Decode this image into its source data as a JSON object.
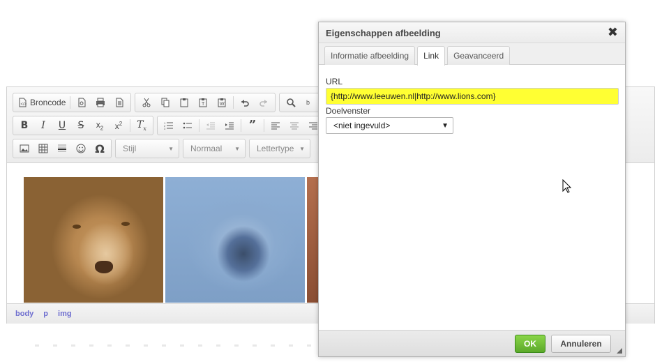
{
  "editor": {
    "toolbar": {
      "source_label": "Broncode",
      "style_combo": "Stijl",
      "format_combo": "Normaal",
      "font_combo": "Lettertype"
    },
    "statusbar": {
      "crumbs": [
        "body",
        "p",
        "img"
      ]
    }
  },
  "dialog": {
    "title": "Eigenschappen afbeelding",
    "tabs": [
      "Informatie afbeelding",
      "Link",
      "Geavanceerd"
    ],
    "active_tab": "Link",
    "url_label": "URL",
    "url_value": "{http://www.leeuwen.nl|http://www.lions.com}",
    "target_label": "Doelvenster",
    "target_value": "<niet ingevuld>",
    "ok_label": "OK",
    "cancel_label": "Annuleren"
  },
  "colors": {
    "url_highlight": "#ffff33",
    "ok_button": "#6ab934",
    "statusbar_link": "#6e6ecf"
  }
}
